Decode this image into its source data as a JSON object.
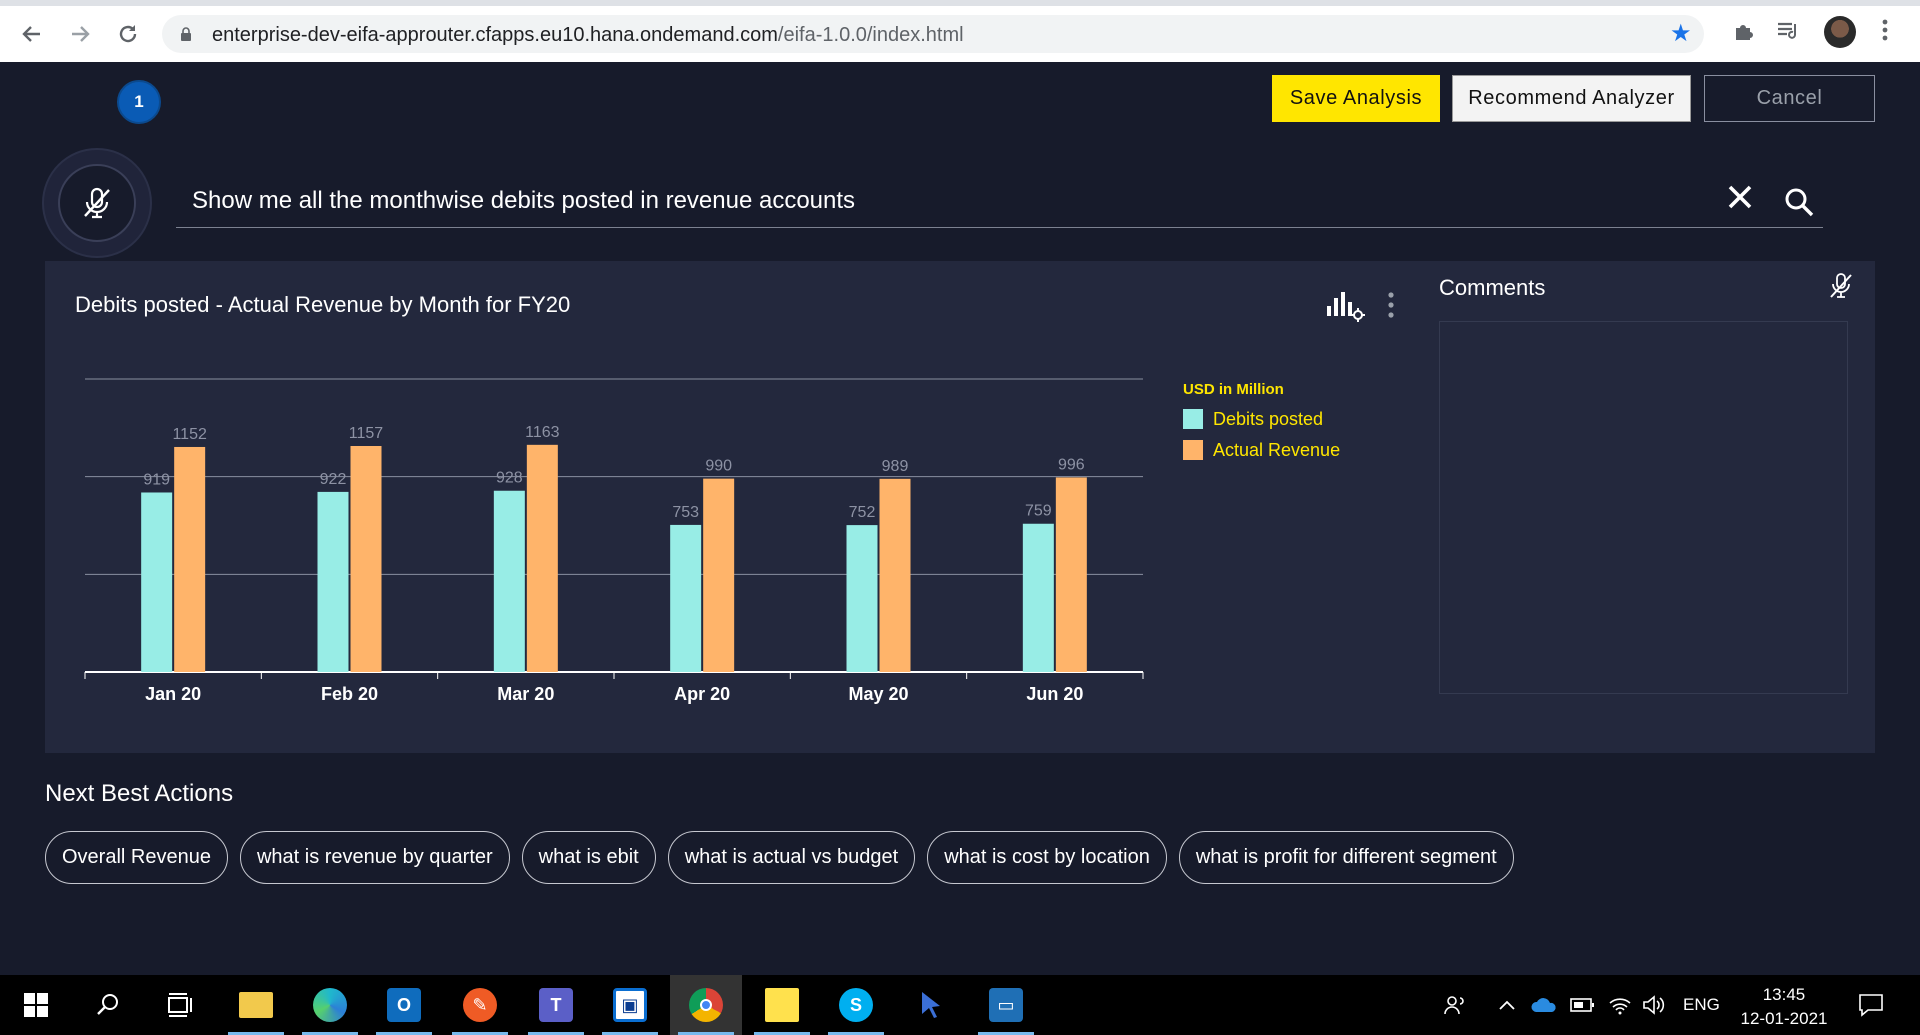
{
  "browser": {
    "url_domain": "enterprise-dev-eifa-approuter.cfapps.eu10.hana.ondemand.com",
    "url_path": "/eifa-1.0.0/index.html"
  },
  "app": {
    "step_number": "1",
    "buttons": {
      "save": "Save Analysis",
      "recommend": "Recommend Analyzer",
      "cancel": "Cancel"
    },
    "query": "Show me all the monthwise debits posted in revenue accounts"
  },
  "chart_panel": {
    "title": "Debits posted - Actual Revenue by Month for FY20"
  },
  "chart_data": {
    "type": "bar",
    "title": "Debits posted - Actual Revenue by Month for FY20",
    "categories": [
      "Jan 20",
      "Feb 20",
      "Mar 20",
      "Apr 20",
      "May 20",
      "Jun 20"
    ],
    "series": [
      {
        "name": "Debits posted",
        "values": [
          919,
          922,
          928,
          753,
          752,
          759
        ],
        "color": "#98ede6"
      },
      {
        "name": "Actual Revenue",
        "values": [
          1152,
          1157,
          1163,
          990,
          989,
          996
        ],
        "color": "#ffb46a"
      }
    ],
    "legend_title": "USD in Million",
    "ylim": [
      0,
      1500
    ],
    "gridlines": [
      500,
      1000,
      1500
    ],
    "legend_position": "right",
    "xlabel": "",
    "ylabel": ""
  },
  "comments": {
    "title": "Comments"
  },
  "next_best_actions": {
    "title": "Next Best Actions",
    "items": [
      "Overall Revenue",
      "what is revenue by quarter",
      "what is ebit",
      "what is actual vs budget",
      "what is cost by location",
      "what is profit for different segment"
    ]
  },
  "taskbar": {
    "language": "ENG",
    "time": "13:45",
    "date": "12-01-2021"
  }
}
